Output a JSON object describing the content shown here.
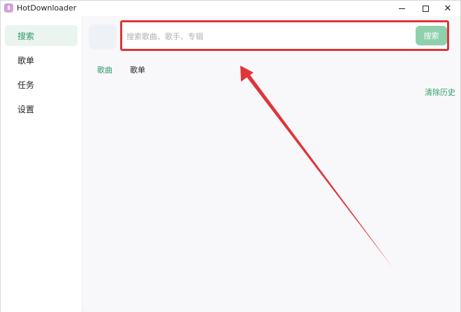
{
  "window": {
    "title": "HotDownloader",
    "controls": [
      "minimize",
      "maximize",
      "close"
    ]
  },
  "sidebar": {
    "items": [
      {
        "label": "搜索",
        "active": true
      },
      {
        "label": "歌单",
        "active": false
      },
      {
        "label": "任务",
        "active": false
      },
      {
        "label": "设置",
        "active": false
      }
    ]
  },
  "search": {
    "placeholder": "搜索歌曲、歌手、专辑",
    "value": "",
    "button_label": "搜索"
  },
  "tabs": [
    {
      "label": "歌曲",
      "active": true
    },
    {
      "label": "歌单",
      "active": false
    }
  ],
  "history": {
    "clear_label": "清除历史"
  },
  "annotation": {
    "highlight_color": "#e0353a",
    "arrow_color": "#e0353a"
  },
  "colors": {
    "accent": "#2e9b68",
    "button_bg": "#8fd0ad",
    "active_nav_bg": "#eaf5ef"
  }
}
